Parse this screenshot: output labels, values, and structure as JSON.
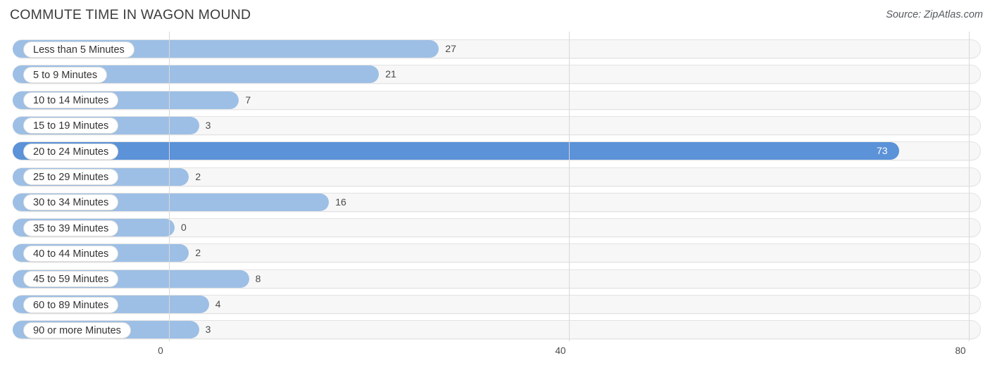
{
  "header": {
    "title": "COMMUTE TIME IN WAGON MOUND",
    "source": "Source: ZipAtlas.com"
  },
  "chart_data": {
    "type": "bar",
    "orientation": "horizontal",
    "title": "COMMUTE TIME IN WAGON MOUND",
    "xlabel": "",
    "ylabel": "",
    "xlim": [
      0,
      80
    ],
    "xticks": [
      0,
      40,
      80
    ],
    "xtick_labels": [
      "0",
      "40",
      "80"
    ],
    "grid": true,
    "legend": false,
    "highlight_category": "20 to 24 Minutes",
    "colors": {
      "bar": "#9dbfe5",
      "bar_highlight": "#5b92d8",
      "track": "#f7f7f7",
      "gridline": "#d8d8d8",
      "text": "#4a4a4a"
    },
    "categories": [
      "Less than 5 Minutes",
      "5 to 9 Minutes",
      "10 to 14 Minutes",
      "15 to 19 Minutes",
      "20 to 24 Minutes",
      "25 to 29 Minutes",
      "30 to 34 Minutes",
      "35 to 39 Minutes",
      "40 to 44 Minutes",
      "45 to 59 Minutes",
      "60 to 89 Minutes",
      "90 or more Minutes"
    ],
    "values": [
      27,
      21,
      7,
      3,
      73,
      2,
      16,
      0,
      2,
      8,
      4,
      3
    ],
    "value_labels": [
      "27",
      "21",
      "7",
      "3",
      "73",
      "2",
      "16",
      "0",
      "2",
      "8",
      "4",
      "3"
    ]
  },
  "rows": [
    {
      "label": "Less than 5 Minutes",
      "value": 27,
      "value_label": "27",
      "highlight": false,
      "label_inside": true
    },
    {
      "label": "5 to 9 Minutes",
      "value": 21,
      "value_label": "21",
      "highlight": false,
      "label_inside": false
    },
    {
      "label": "10 to 14 Minutes",
      "value": 7,
      "value_label": "7",
      "highlight": false,
      "label_inside": false
    },
    {
      "label": "15 to 19 Minutes",
      "value": 3,
      "value_label": "3",
      "highlight": false,
      "label_inside": false
    },
    {
      "label": "20 to 24 Minutes",
      "value": 73,
      "value_label": "73",
      "highlight": true,
      "label_inside": true
    },
    {
      "label": "25 to 29 Minutes",
      "value": 2,
      "value_label": "2",
      "highlight": false,
      "label_inside": false
    },
    {
      "label": "30 to 34 Minutes",
      "value": 16,
      "value_label": "16",
      "highlight": false,
      "label_inside": false
    },
    {
      "label": "35 to 39 Minutes",
      "value": 0,
      "value_label": "0",
      "highlight": false,
      "label_inside": false
    },
    {
      "label": "40 to 44 Minutes",
      "value": 2,
      "value_label": "2",
      "highlight": false,
      "label_inside": false
    },
    {
      "label": "45 to 59 Minutes",
      "value": 8,
      "value_label": "8",
      "highlight": false,
      "label_inside": false
    },
    {
      "label": "60 to 89 Minutes",
      "value": 4,
      "value_label": "4",
      "highlight": false,
      "label_inside": false
    },
    {
      "label": "90 or more Minutes",
      "value": 3,
      "value_label": "3",
      "highlight": false,
      "label_inside": false
    }
  ],
  "axis": {
    "ticks": [
      {
        "label": "0",
        "value": 0
      },
      {
        "label": "40",
        "value": 40
      },
      {
        "label": "80",
        "value": 80
      }
    ]
  }
}
